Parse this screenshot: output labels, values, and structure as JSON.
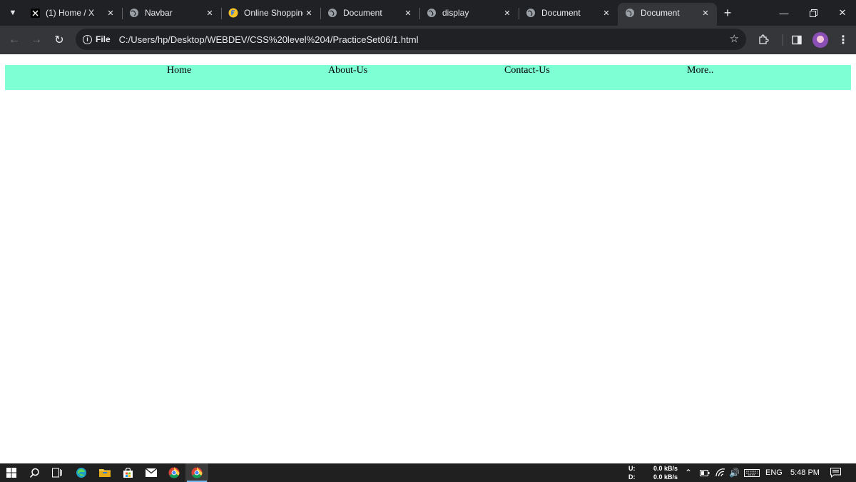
{
  "browser": {
    "tabs": [
      {
        "title": "(1) Home / X",
        "favicon": "x-logo-icon",
        "active": false
      },
      {
        "title": "Navbar",
        "favicon": "globe-icon",
        "active": false
      },
      {
        "title": "Online Shopping",
        "favicon": "flipkart-icon",
        "active": false
      },
      {
        "title": "Document",
        "favicon": "globe-icon",
        "active": false
      },
      {
        "title": "display",
        "favicon": "globe-icon",
        "active": false
      },
      {
        "title": "Document",
        "favicon": "globe-icon",
        "active": false
      },
      {
        "title": "Document",
        "favicon": "globe-icon",
        "active": true
      }
    ],
    "site_chip": "File",
    "url": "C:/Users/hp/Desktop/WEBDEV/CSS%20level%204/PracticeSet06/1.html"
  },
  "page": {
    "navbar": {
      "background": "#7fffd4",
      "items": [
        {
          "label": "Home"
        },
        {
          "label": "About-Us"
        },
        {
          "label": "Contact-Us"
        },
        {
          "label": "More.."
        }
      ]
    }
  },
  "taskbar": {
    "net_up_label": "U:",
    "net_up_value": "0.0 kB/s",
    "net_down_label": "D:",
    "net_down_value": "0.0 kB/s",
    "language": "ENG",
    "time": "5:48 PM"
  },
  "colors": {
    "tabstrip": "#202124",
    "toolbar": "#35363a",
    "taskbar": "#202020"
  }
}
